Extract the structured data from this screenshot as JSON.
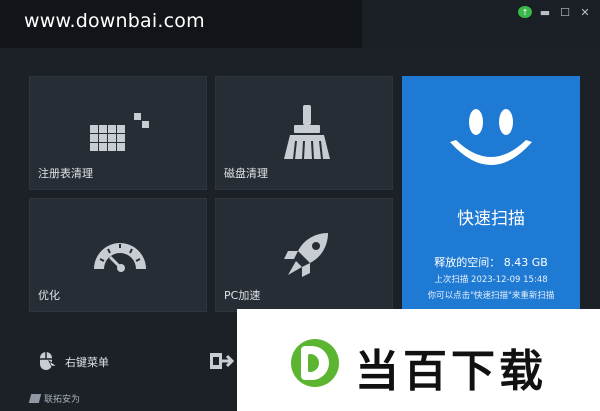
{
  "watermark": {
    "site": "www.downbai.com"
  },
  "window": {
    "update_icon": "update-icon",
    "minimize_icon": "minimize-icon",
    "maximize_icon": "maximize-icon",
    "close_icon": "close-icon"
  },
  "tiles": [
    {
      "label": "注册表清理",
      "icon": "registry-blocks-icon"
    },
    {
      "label": "磁盘清理",
      "icon": "broom-icon"
    },
    {
      "label": "优化",
      "icon": "speedometer-icon"
    },
    {
      "label": "PC加速",
      "icon": "rocket-icon"
    }
  ],
  "scan": {
    "title": "快速扫描",
    "free_space": "释放的空间： 8.43 GB",
    "last_scan": "上次扫描 2023-12-09 15:48",
    "hint": "你可以点击\"快速扫描\"来重新扫描",
    "icon": "smiley-icon",
    "color": "#1f7ad4"
  },
  "bottom": {
    "context_menu_label": "右键菜单",
    "mouse_icon": "mouse-icon",
    "export_icon": "export-icon"
  },
  "footer": {
    "brand": "联拓安为"
  },
  "ad": {
    "text": "当百下载",
    "logo_color": "#5cb531"
  }
}
